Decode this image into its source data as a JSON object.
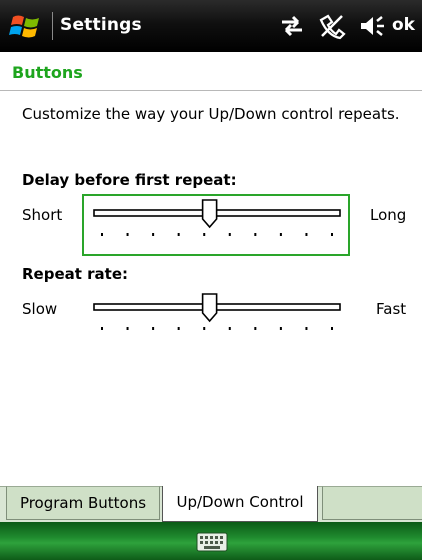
{
  "titlebar": {
    "title": "Settings",
    "ok_label": "ok",
    "status_icons": [
      "connectivity-icon",
      "phone-off-icon",
      "volume-icon"
    ]
  },
  "header": {
    "title": "Buttons"
  },
  "description": "Customize the way your Up/Down control repeats.",
  "delay": {
    "label": "Delay before first repeat:",
    "min_label": "Short",
    "max_label": "Long",
    "value": 0.47,
    "tick_count": 10
  },
  "rate": {
    "label": "Repeat rate:",
    "min_label": "Slow",
    "max_label": "Fast",
    "value": 0.47,
    "tick_count": 10
  },
  "tabs": [
    {
      "label": "Program Buttons",
      "selected": false
    },
    {
      "label": "Up/Down Control",
      "selected": true
    }
  ],
  "softbar": {
    "icon": "keyboard-icon"
  },
  "colors": {
    "accent": "#1ea51e",
    "focus_border": "#2aa52a",
    "titlebar": "#000000",
    "softbar": "#1f8a2e",
    "tab_inactive": "#cfe0c7"
  }
}
